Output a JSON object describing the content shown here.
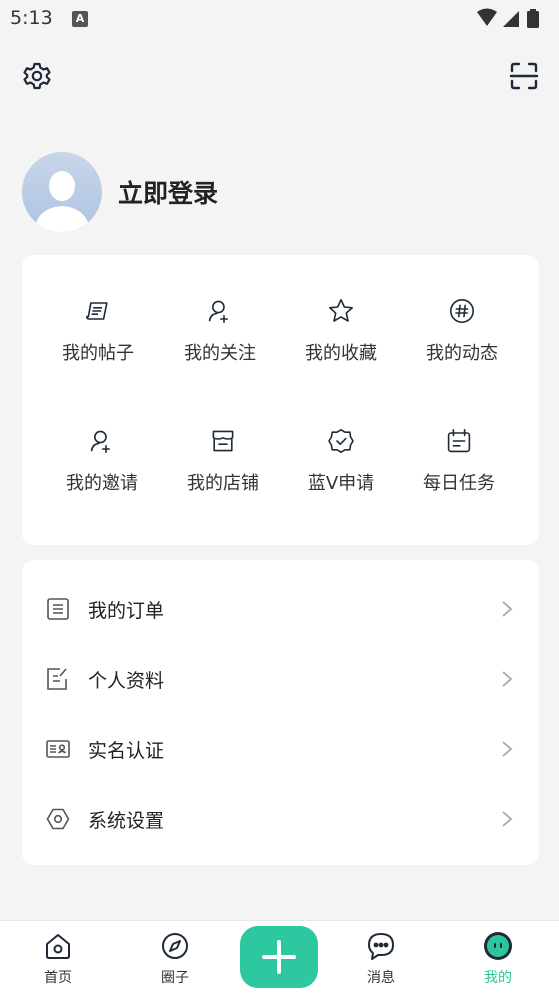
{
  "status_bar": {
    "time": "5:13",
    "notification_badge": "A"
  },
  "profile": {
    "login_text": "立即登录"
  },
  "grid": [
    {
      "label": "我的帖子",
      "icon": "post-icon"
    },
    {
      "label": "我的关注",
      "icon": "follow-icon"
    },
    {
      "label": "我的收藏",
      "icon": "star-icon"
    },
    {
      "label": "我的动态",
      "icon": "hashtag-icon"
    },
    {
      "label": "我的邀请",
      "icon": "invite-icon"
    },
    {
      "label": "我的店铺",
      "icon": "store-icon"
    },
    {
      "label": "蓝V申请",
      "icon": "badge-check-icon"
    },
    {
      "label": "每日任务",
      "icon": "calendar-icon"
    }
  ],
  "menu": [
    {
      "label": "我的订单",
      "icon": "order-icon"
    },
    {
      "label": "个人资料",
      "icon": "edit-doc-icon"
    },
    {
      "label": "实名认证",
      "icon": "id-card-icon"
    },
    {
      "label": "系统设置",
      "icon": "hexagon-settings-icon"
    }
  ],
  "nav": [
    {
      "label": "首页",
      "icon": "home-icon"
    },
    {
      "label": "圈子",
      "icon": "compass-icon"
    },
    {
      "label": "消息",
      "icon": "chat-icon"
    },
    {
      "label": "我的",
      "icon": "profile-face-icon",
      "active": true
    }
  ],
  "colors": {
    "accent": "#2dc7a0",
    "active_nav": "#2fc59c",
    "icon_stroke": "#1f2937"
  }
}
